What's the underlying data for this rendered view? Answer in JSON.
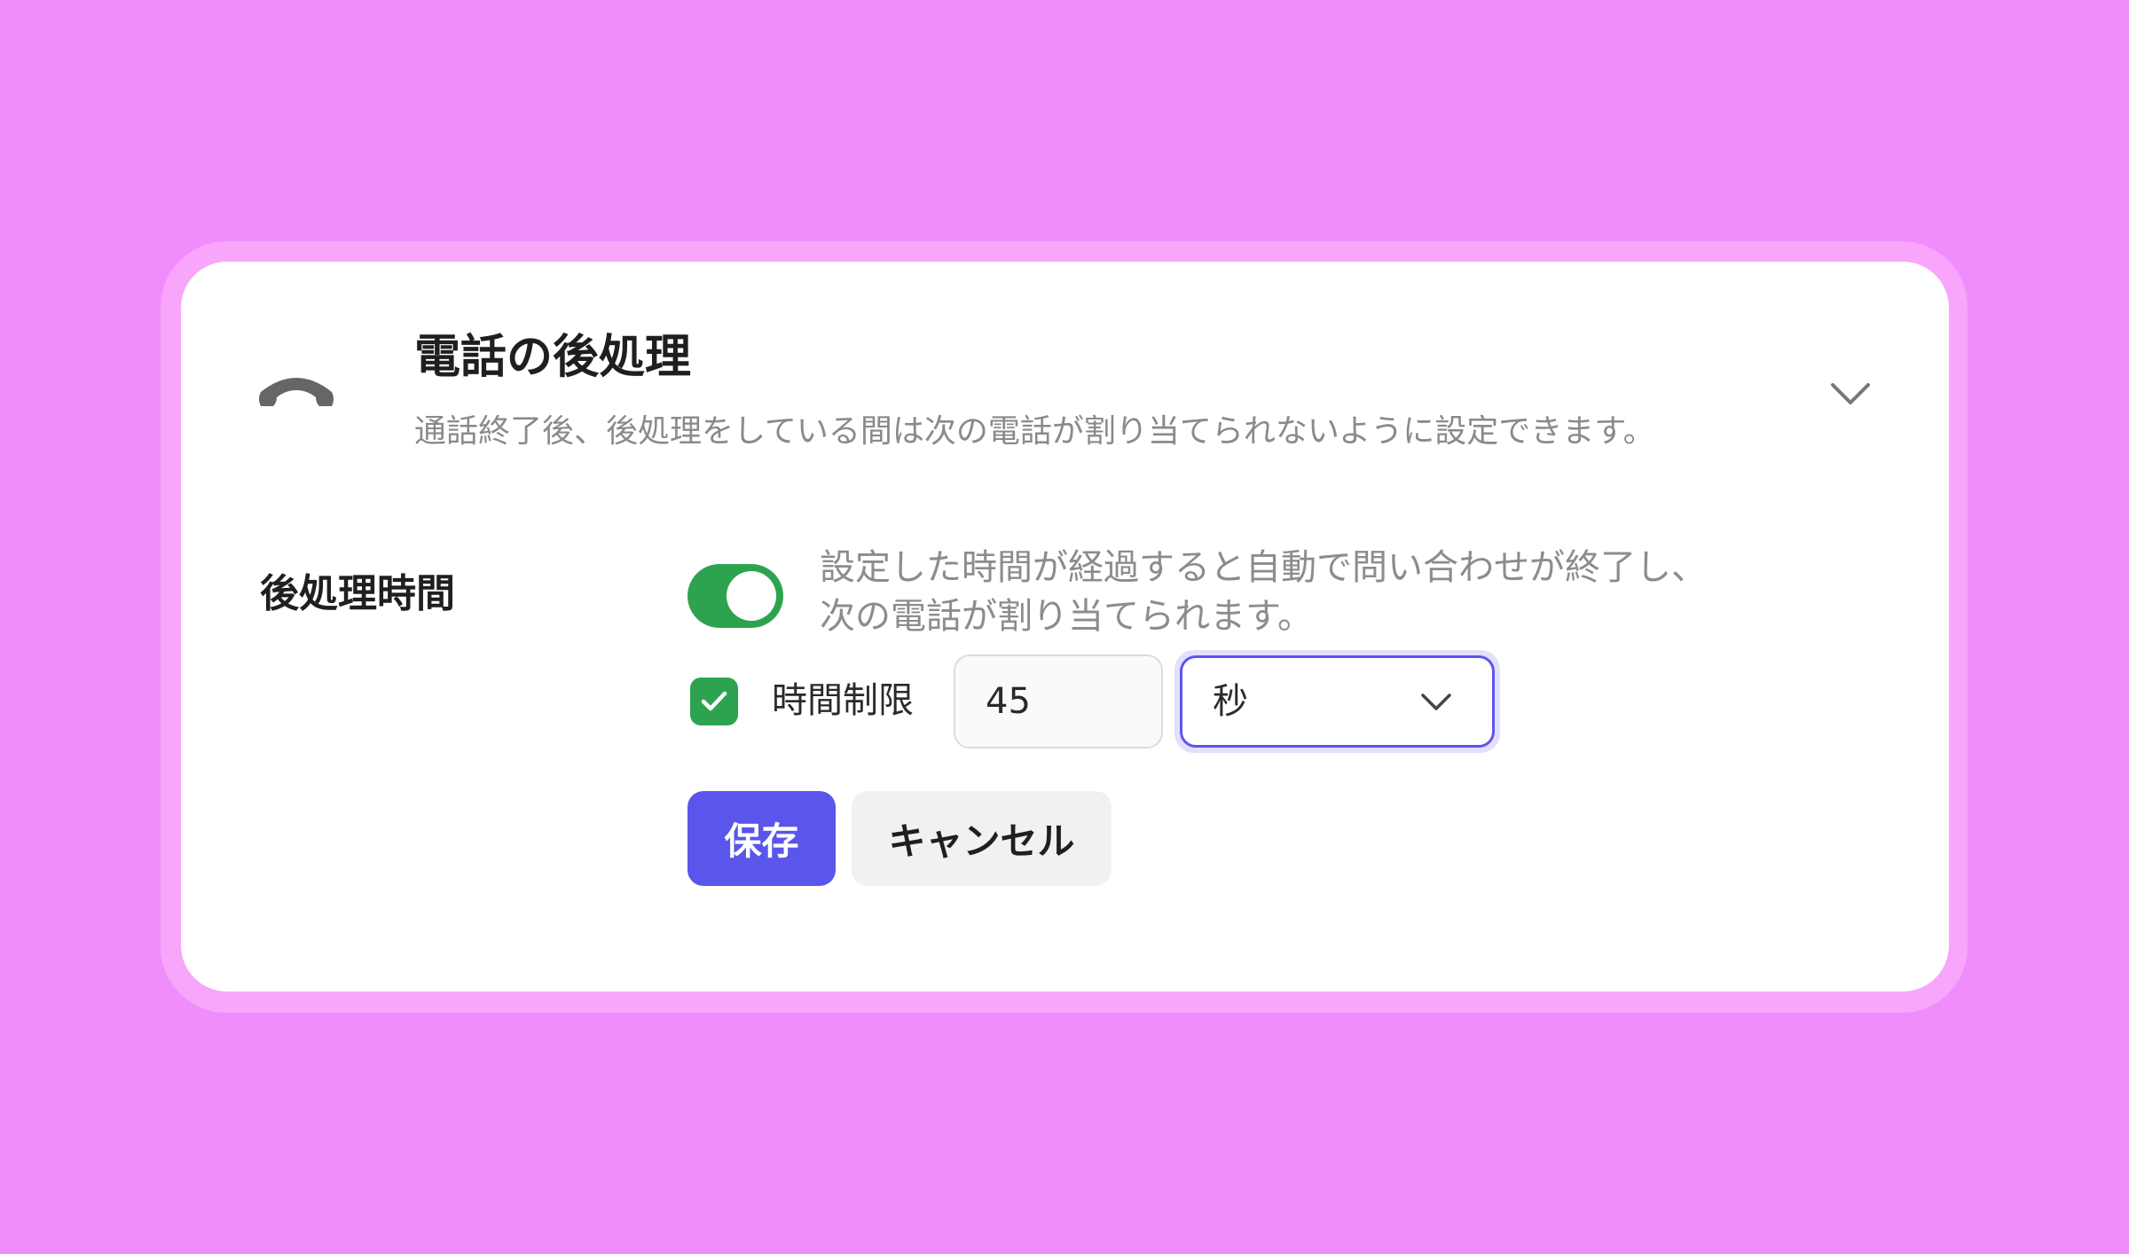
{
  "colors": {
    "background": "#f08cfc",
    "card": "#ffffff",
    "accent_purple": "#5a55eb",
    "toggle_green": "#2ea34f",
    "muted_text": "#8a8a8a",
    "icon_gray": "#666666"
  },
  "header": {
    "icon": "phone-hangup-icon",
    "title": "電話の後処理",
    "description": "通話終了後、後処理をしている間は次の電話が割り当てられないように設定できます。",
    "expand_icon": "chevron-down-icon"
  },
  "setting": {
    "label": "後処理時間",
    "toggle": {
      "on": true,
      "description_line1": "設定した時間が経過すると自動で問い合わせが終了し、",
      "description_line2": "次の電話が割り当てられます。"
    },
    "time_limit": {
      "checked": true,
      "label": "時間制限",
      "value": "45",
      "unit": "秒"
    }
  },
  "actions": {
    "save_label": "保存",
    "cancel_label": "キャンセル"
  }
}
